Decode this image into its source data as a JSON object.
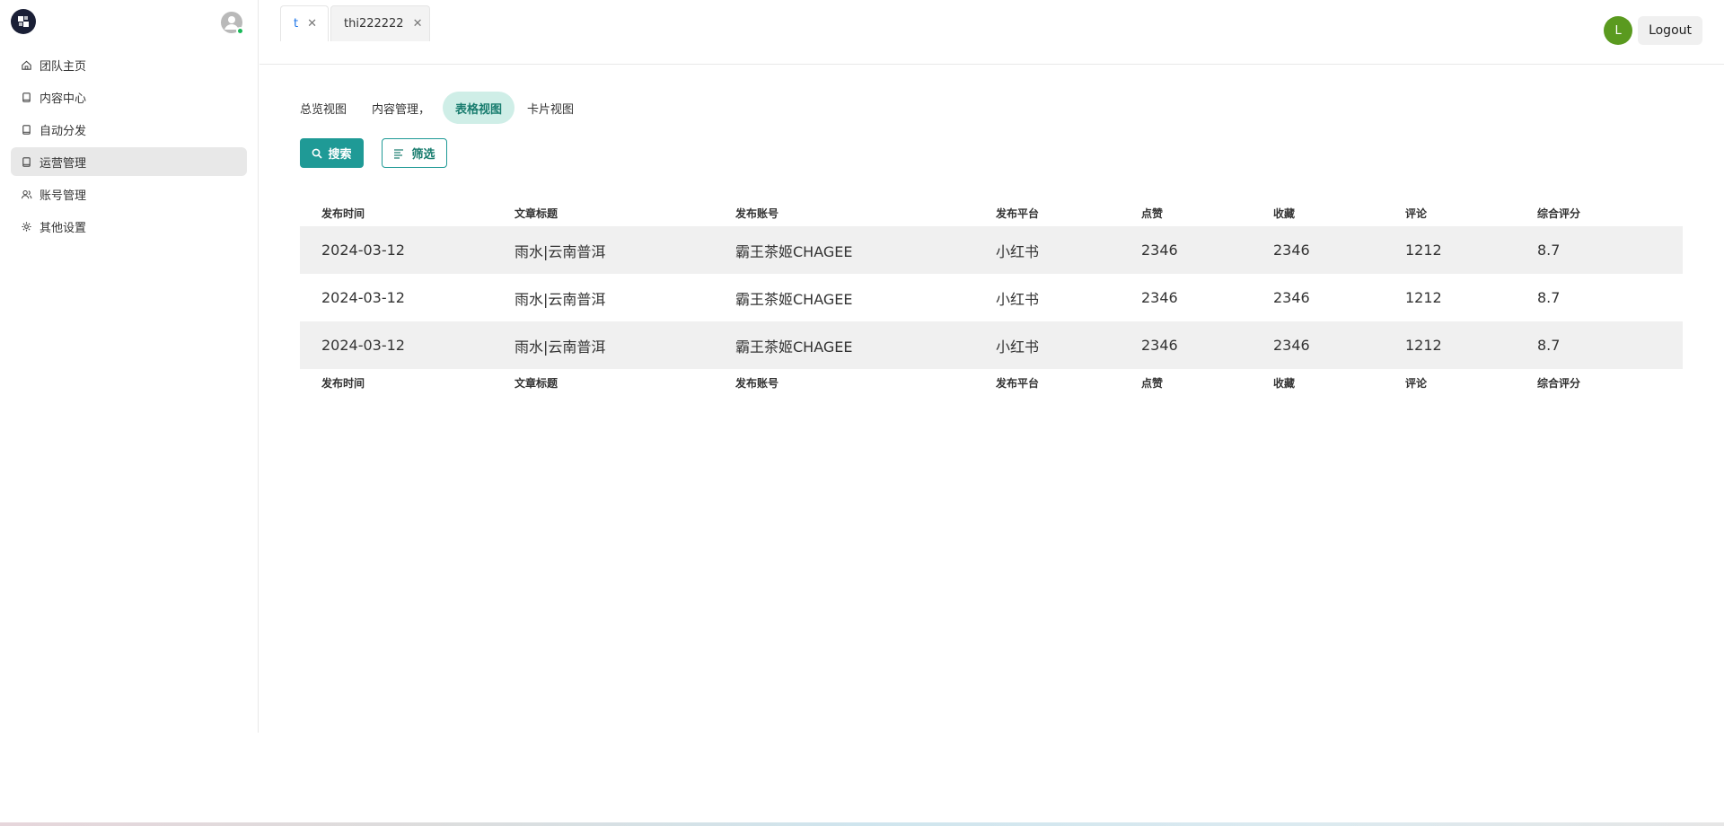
{
  "sidebar": {
    "items": [
      {
        "label": "团队主页",
        "icon": "home-icon"
      },
      {
        "label": "内容中心",
        "icon": "book-icon"
      },
      {
        "label": "自动分发",
        "icon": "book-icon"
      },
      {
        "label": "运营管理",
        "icon": "book-icon",
        "active": true
      },
      {
        "label": "账号管理",
        "icon": "users-icon"
      },
      {
        "label": "其他设置",
        "icon": "gear-icon"
      }
    ]
  },
  "tabs": [
    {
      "label": "t",
      "active": true
    },
    {
      "label": "thi222222",
      "active": false
    }
  ],
  "header": {
    "avatar_initial": "L",
    "avatar_color": "#5a9a1f",
    "logout_label": "Logout"
  },
  "views": [
    {
      "label": "总览视图",
      "active": false
    },
    {
      "label": "内容管理，",
      "active": false
    },
    {
      "label": "表格视图",
      "active": true
    },
    {
      "label": "卡片视图",
      "active": false
    }
  ],
  "actions": {
    "search_label": "搜索",
    "filter_label": "筛选",
    "accent_color": "#1f9a96"
  },
  "table": {
    "columns": [
      "发布时间",
      "文章标题",
      "发布账号",
      "发布平台",
      "点赞",
      "收藏",
      "评论",
      "综合评分"
    ],
    "rows": [
      [
        "2024-03-12",
        "雨水|云南普洱",
        "霸王茶姬CHAGEE",
        "小红书",
        "2346",
        "2346",
        "1212",
        "8.7"
      ],
      [
        "2024-03-12",
        "雨水|云南普洱",
        "霸王茶姬CHAGEE",
        "小红书",
        "2346",
        "2346",
        "1212",
        "8.7"
      ],
      [
        "2024-03-12",
        "雨水|云南普洱",
        "霸王茶姬CHAGEE",
        "小红书",
        "2346",
        "2346",
        "1212",
        "8.7"
      ]
    ]
  }
}
